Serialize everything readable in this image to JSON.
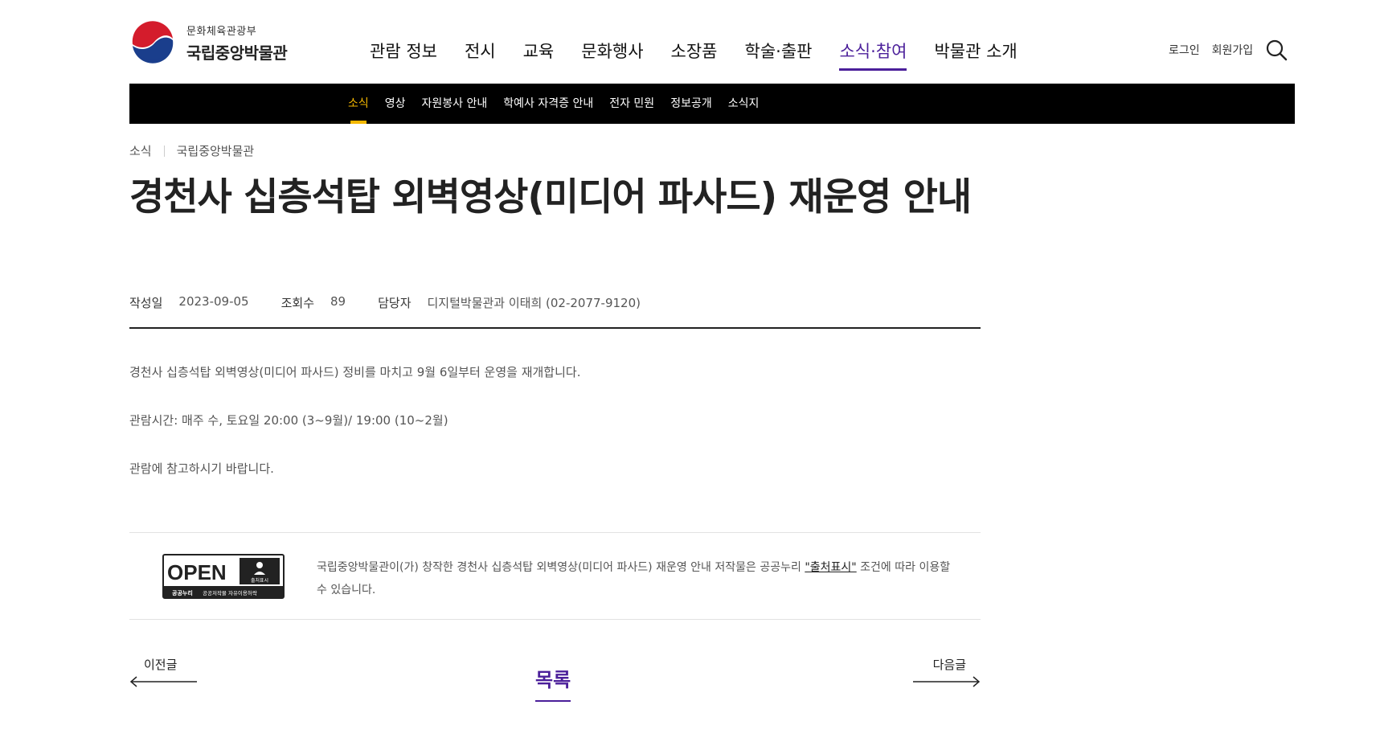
{
  "header": {
    "logo_sub": "문화체육관광부",
    "logo_main": "국립중앙박물관",
    "nav": [
      {
        "label": "관람 정보"
      },
      {
        "label": "전시"
      },
      {
        "label": "교육"
      },
      {
        "label": "문화행사"
      },
      {
        "label": "소장품"
      },
      {
        "label": "학술·출판"
      },
      {
        "label": "소식·참여"
      },
      {
        "label": "박물관 소개"
      }
    ],
    "active_nav": "소식·참여",
    "login": "로그인",
    "signup": "회원가입",
    "search_icon": "search-icon"
  },
  "subnav": {
    "items": [
      {
        "label": "소식"
      },
      {
        "label": "영상"
      },
      {
        "label": "자원봉사 안내"
      },
      {
        "label": "학예사 자격증 안내"
      },
      {
        "label": "전자 민원"
      },
      {
        "label": "정보공개"
      },
      {
        "label": "소식지"
      }
    ],
    "active": "소식"
  },
  "breadcrumb": [
    "소식",
    "국립중앙박물관"
  ],
  "article": {
    "title": "경천사 십층석탑 외벽영상(미디어 파사드) 재운영 안내",
    "meta": {
      "date_label": "작성일",
      "date": "2023-09-05",
      "views_label": "조회수",
      "views": "89",
      "manager_label": "담당자",
      "manager": "디지털박물관과 이태희 (02-2077-9120)"
    },
    "body": [
      "경천사 십층석탑 외벽영상(미디어 파사드) 정비를 마치고 9월 6일부터 운영을 재개합니다.",
      "관람시간: 매주 수, 토요일 20:00 (3~9월)/ 19:00 (10~2월)",
      "관람에 참고하시기 바랍니다."
    ]
  },
  "license": {
    "badge_open": "OPEN",
    "badge_attr": "출처표시",
    "badge_caption_left": "공공누리",
    "badge_caption_right": "공공저작물 자유이용허락",
    "text_before": "국립중앙박물관이(가) 창작한 경천사 십층석탑 외벽영상(미디어 파사드) 재운영 안내 저작물은 공공누리 ",
    "link": "\"출처표시\"",
    "text_after": " 조건에 따라 이용할 수 있습니다."
  },
  "pager": {
    "prev": "이전글",
    "list": "목록",
    "next": "다음글"
  },
  "colors": {
    "accent": "#4b1f9a",
    "subnav_active": "#f5b800",
    "subnav_bg": "#000000"
  }
}
